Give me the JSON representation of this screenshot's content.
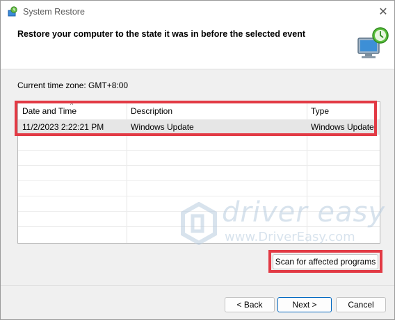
{
  "window": {
    "title": "System Restore",
    "close_glyph": "✕"
  },
  "header": {
    "text": "Restore your computer to the state it was in before the selected event"
  },
  "timezone": {
    "text": "Current time zone: GMT+8:00"
  },
  "table": {
    "columns": [
      "Date and Time",
      "Description",
      "Type"
    ],
    "rows": [
      {
        "date": "11/2/2023 2:22:21 PM",
        "description": "Windows Update",
        "type": "Windows Update"
      }
    ]
  },
  "buttons": {
    "scan": "Scan for affected programs",
    "back": "< Back",
    "next": "Next >",
    "cancel": "Cancel"
  },
  "watermark": {
    "brand": "driver easy",
    "url": "www.DriverEasy.com"
  },
  "colors": {
    "highlight": "#e23a45",
    "selected_row": "#e6e6e6",
    "watermark": "#b9cde0"
  },
  "icons": [
    "system-restore-icon",
    "close-icon",
    "restore-monitor-icon",
    "sort-caret-icon",
    "driver-easy-logo-icon"
  ]
}
